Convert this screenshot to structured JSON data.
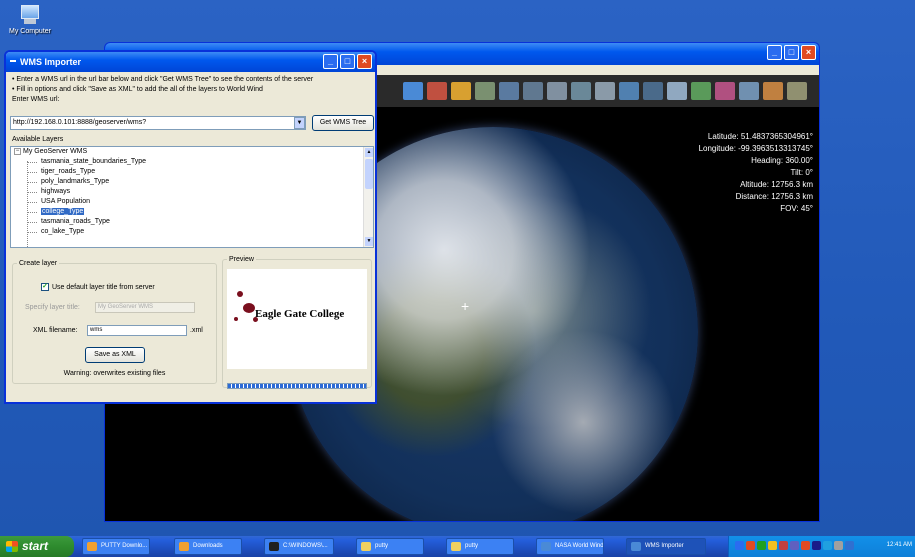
{
  "desktop": {
    "icon_label": "My Computer"
  },
  "worldwind": {
    "readout": {
      "latitude": "Latitude: 51.4837365304961°",
      "longitude": "Longitude: -99.3963513313745°",
      "heading": "Heading: 360.00°",
      "tilt": "Tilt: 0°",
      "altitude": "Altitude: 12756.3 km",
      "distance": "Distance: 12756.3 km",
      "fov": "FOV: 45°"
    },
    "crosshair": "+"
  },
  "wms": {
    "title": "WMS Importer",
    "instructions": [
      "• Enter a WMS url in the url bar below and click \"Get WMS Tree\" to see the contents of the server",
      "• Fill in options and click \"Save as XML\" to add the all of the layers to World Wind"
    ],
    "url_label": "Enter WMS url:",
    "url_value": "http://192.168.0.101:8888/geoserver/wms?",
    "get_tree_button": "Get WMS Tree",
    "available_label": "Available Layers",
    "tree_root": "My GeoServer WMS",
    "tree_items": [
      "tasmania_state_boundaries_Type",
      "tiger_roads_Type",
      "poly_landmarks_Type",
      "highways",
      "USA Population",
      "college_Type",
      "tasmania_roads_Type",
      "co_lake_Type"
    ],
    "selected_item": "college_Type",
    "create_legend": "Create layer",
    "use_default_label": "Use default layer title from server",
    "specify_label": "Specify layer title:",
    "specify_value": "My GeoServer WMS",
    "xml_label": "XML filename:",
    "xml_value": "wms",
    "xml_ext": ".xml",
    "save_button": "Save as XML",
    "warning": "Warning: overwrites existing files",
    "preview_legend": "Preview",
    "preview_text": "Eagle Gate College"
  },
  "taskbar": {
    "start": "start",
    "buttons": [
      "PUTTY Downlo...",
      "Downloads",
      "C:\\WINDOWS\\...",
      "putty",
      "putty",
      "NASA World Wind",
      "WMS Importer"
    ],
    "clock": "12:41 AM"
  },
  "colors": {
    "xp_blue": "#0058ee",
    "desktop": "#2159b8",
    "selection": "#316ac5"
  }
}
